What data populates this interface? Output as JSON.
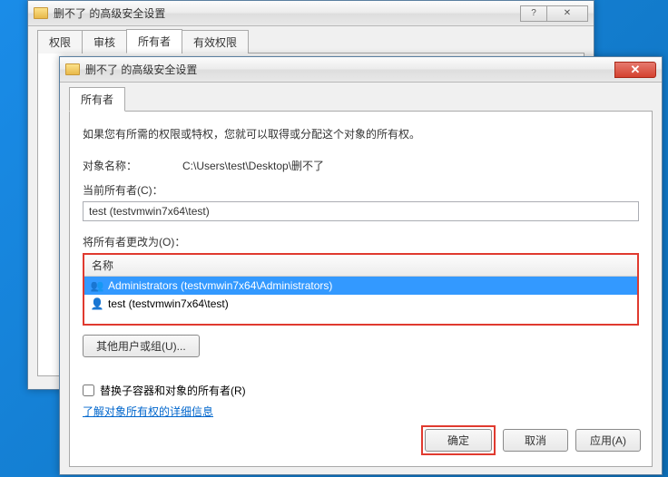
{
  "back_window": {
    "title": "删不了 的高级安全设置",
    "tabs": [
      "权限",
      "审核",
      "所有者",
      "有效权限"
    ],
    "active_tab_index": 2
  },
  "front_window": {
    "title": "删不了 的高级安全设置",
    "tab": "所有者",
    "description": "如果您有所需的权限或特权，您就可以取得或分配这个对象的所有权。",
    "object_name_label": "对象名称：",
    "object_name_value": "C:\\Users\\test\\Desktop\\删不了",
    "current_owner_label": "当前所有者(C)：",
    "current_owner_value": "test (testvmwin7x64\\test)",
    "change_owner_label": "将所有者更改为(O)：",
    "list_header": "名称",
    "owners": [
      {
        "name": "Administrators (testvmwin7x64\\Administrators)",
        "icon": "users-icon",
        "selected": true
      },
      {
        "name": "test (testvmwin7x64\\test)",
        "icon": "user-icon",
        "selected": false
      }
    ],
    "other_users_btn": "其他用户或组(U)...",
    "replace_checkbox_label": "替换子容器和对象的所有者(R)",
    "learn_link": "了解对象所有权的详细信息",
    "buttons": {
      "ok": "确定",
      "cancel": "取消",
      "apply": "应用(A)"
    }
  }
}
